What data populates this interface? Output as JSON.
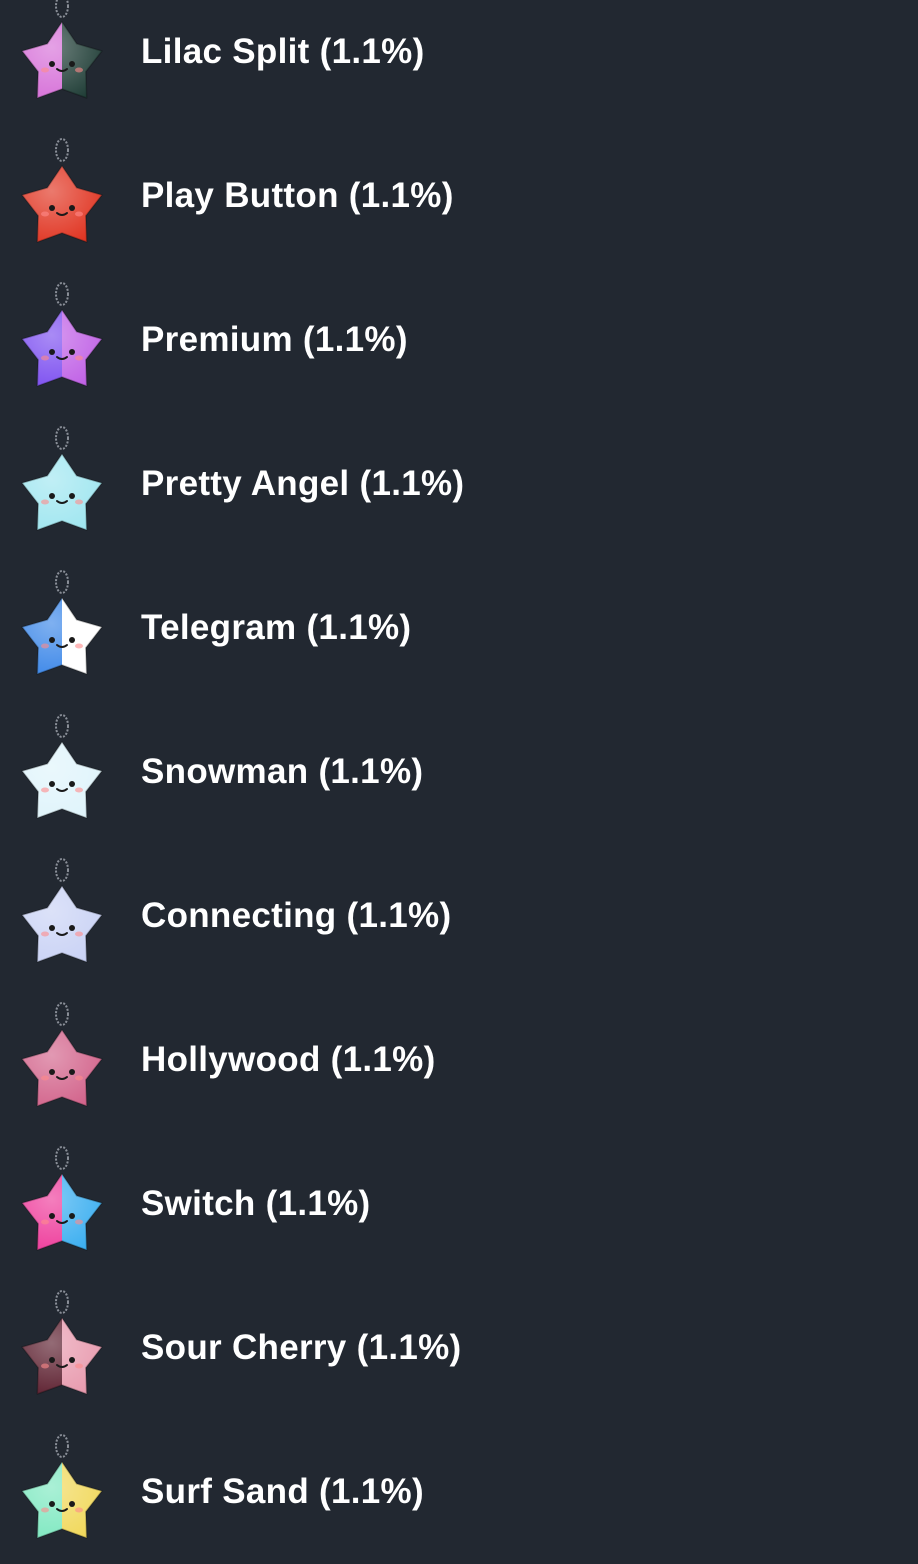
{
  "items": [
    {
      "name": "Lilac Split",
      "pct": "(1.1%)",
      "icon": "lilac-split-star-icon",
      "colors": [
        "#d66fd8",
        "#1f3d36"
      ]
    },
    {
      "name": "Play Button",
      "pct": "(1.1%)",
      "icon": "play-button-star-icon",
      "colors": [
        "#e0321f",
        "#e0321f"
      ]
    },
    {
      "name": "Premium",
      "pct": "(1.1%)",
      "icon": "premium-star-icon",
      "colors": [
        "#7b4df0",
        "#c061e6"
      ]
    },
    {
      "name": "Pretty Angel",
      "pct": "(1.1%)",
      "icon": "pretty-angel-star-icon",
      "colors": [
        "#9fe6f0",
        "#9fe6f0"
      ]
    },
    {
      "name": "Telegram",
      "pct": "(1.1%)",
      "icon": "telegram-star-icon",
      "colors": [
        "#3a86e8",
        "#ffffff"
      ]
    },
    {
      "name": "Snowman",
      "pct": "(1.1%)",
      "icon": "snowman-star-icon",
      "colors": [
        "#dff4fb",
        "#dff4fb"
      ]
    },
    {
      "name": "Connecting",
      "pct": "(1.1%)",
      "icon": "connecting-star-icon",
      "colors": [
        "#c9d2f5",
        "#c9d2f5"
      ]
    },
    {
      "name": "Hollywood",
      "pct": "(1.1%)",
      "icon": "hollywood-star-icon",
      "colors": [
        "#d2628a",
        "#d2628a"
      ]
    },
    {
      "name": "Switch",
      "pct": "(1.1%)",
      "icon": "switch-star-icon",
      "colors": [
        "#ee3a9a",
        "#3aaef0"
      ]
    },
    {
      "name": "Sour Cherry",
      "pct": "(1.1%)",
      "icon": "sour-cherry-star-icon",
      "colors": [
        "#5a1c2c",
        "#e89aae"
      ]
    },
    {
      "name": "Surf Sand",
      "pct": "(1.1%)",
      "icon": "surf-sand-star-icon",
      "colors": [
        "#7de8c0",
        "#f1d85a"
      ]
    }
  ]
}
